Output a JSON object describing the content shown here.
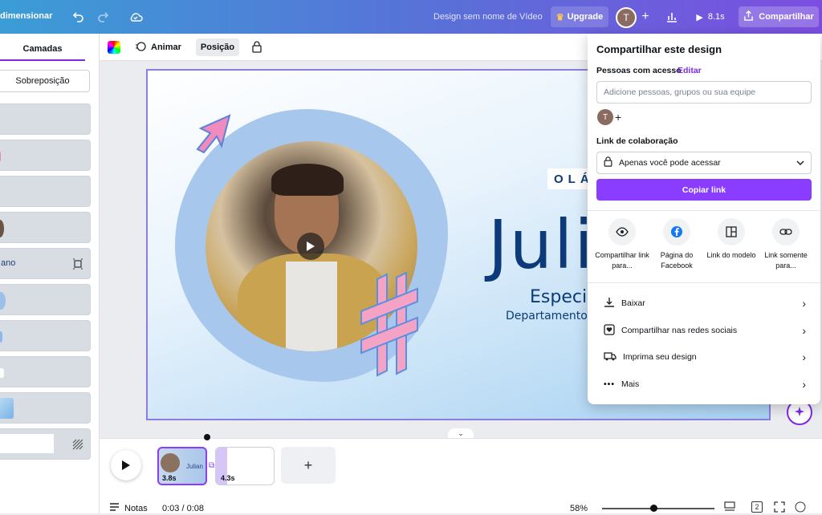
{
  "topbar": {
    "brand_label": "dimensionar",
    "design_name": "Design sem nome de Vídeo",
    "upgrade_label": "Upgrade",
    "avatar_initial": "T",
    "duration_label": "8.1s",
    "share_label": "Compartilhar"
  },
  "left_panel": {
    "tab_label": "Camadas",
    "overlay_label": "Sobreposição",
    "layer_text_fragment": "ano"
  },
  "toolbar": {
    "animate_label": "Animar",
    "position_label": "Posição"
  },
  "slide": {
    "hello_text": "OLÁ,",
    "name_text": "Juli",
    "subtitle_text": "Especi",
    "department_text": "Departamento d"
  },
  "share_panel": {
    "title": "Compartilhar este design",
    "access_label": "Pessoas com acesso",
    "edit_label": "Editar",
    "people_placeholder": "Adicione pessoas, grupos ou sua equipe",
    "avatar_initial": "T",
    "link_label": "Link de colaboração",
    "link_option": "Apenas você pode acessar",
    "copy_link_label": "Copiar link",
    "options": [
      {
        "label": "Compartilhar link para...",
        "icon": "eye-icon"
      },
      {
        "label": "Página do Facebook",
        "icon": "facebook-icon"
      },
      {
        "label": "Link do modelo",
        "icon": "template-icon"
      },
      {
        "label": "Link somente para...",
        "icon": "link-icon"
      }
    ],
    "rows": [
      {
        "label": "Baixar",
        "icon": "download-icon"
      },
      {
        "label": "Compartilhar nas redes sociais",
        "icon": "heart-icon"
      },
      {
        "label": "Imprima seu design",
        "icon": "truck-icon"
      },
      {
        "label": "Mais",
        "icon": "more-icon"
      }
    ]
  },
  "timeline": {
    "clip1_duration": "3.8s",
    "clip1_text": "Julian",
    "clip2_duration": "4.3s",
    "notes_label": "Notas",
    "timecode": "0:03 / 0:08",
    "zoom": "58%",
    "page_count": "2"
  },
  "colors": {
    "accent": "#8b3dff",
    "brand_text": "#0d3a78"
  }
}
